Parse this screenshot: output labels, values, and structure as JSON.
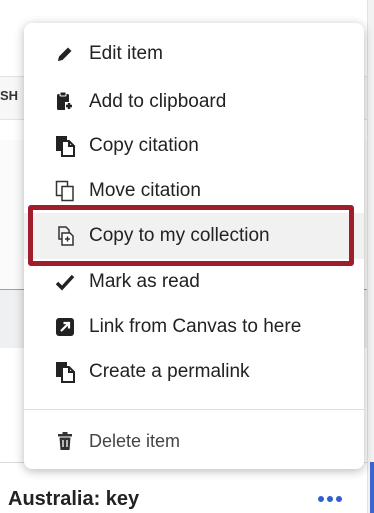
{
  "background": {
    "column_header_fragment": "SH",
    "item_title": "Australia: key",
    "more_icon": "more-horizontal-icon",
    "accent_color": "#3b66d1"
  },
  "menu": {
    "items": [
      {
        "label": "Edit item",
        "icon": "pencil-icon"
      },
      {
        "label": "Add to clipboard",
        "icon": "clipboard-icon"
      },
      {
        "label": "Copy citation",
        "icon": "copy-citation-icon"
      },
      {
        "label": "Move citation",
        "icon": "move-citation-icon"
      },
      {
        "label": "Copy to my collection",
        "icon": "copy-to-collection-icon",
        "state": "highlighted"
      },
      {
        "label": "Mark as read",
        "icon": "checkmark-icon"
      },
      {
        "label": "Link from Canvas to here",
        "icon": "external-link-icon"
      },
      {
        "label": "Create a permalink",
        "icon": "permalink-icon"
      }
    ],
    "footer_item": {
      "label": "Delete item",
      "icon": "trash-icon"
    },
    "highlight_color": "#a11d2b"
  }
}
